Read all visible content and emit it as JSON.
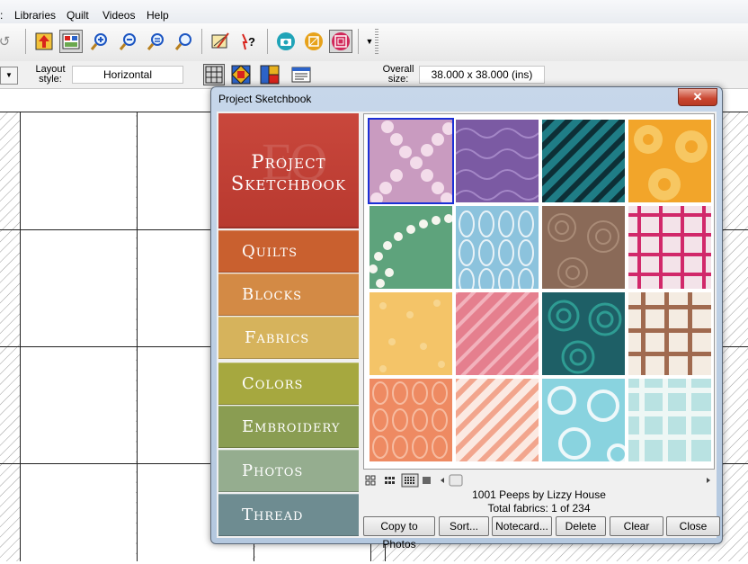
{
  "menu": {
    "items": [
      "Libraries",
      "Quilt",
      "Videos",
      "Help"
    ]
  },
  "toolbar": {
    "icons": [
      "undo-icon",
      "move-icon",
      "worktable-icon",
      "zoom-in-icon",
      "zoom-out-icon",
      "zoom-fit-icon",
      "zoom-page-icon",
      "draw-icon",
      "hint-icon",
      "camera-icon",
      "fabric-icon",
      "sketchbook-icon"
    ]
  },
  "layoutbar": {
    "layout_label_line1": "Layout",
    "layout_label_line2": "style:",
    "layout_style_value": "Horizontal",
    "overall_label_line1": "Overall",
    "overall_label_line2": "size:",
    "overall_size_value": "38.000 x 38.000 (ins)",
    "dropdown_arrow": "▼"
  },
  "dialog": {
    "title": "Project Sketchbook",
    "close_glyph": "✕",
    "header_title_line1": "Project",
    "header_title_line2": "Sketchbook",
    "header_watermark": "EQ",
    "sections": [
      {
        "label": "Quilts",
        "color": "#c9602f"
      },
      {
        "label": "Blocks",
        "color": "#d38a45"
      },
      {
        "label": "Fabrics",
        "color": "#d6b35c"
      },
      {
        "label": "Colors",
        "color": "#a6a83f"
      },
      {
        "label": "Embroidery",
        "color": "#8a9d52"
      },
      {
        "label": "Photos",
        "color": "#95ad8f"
      },
      {
        "label": "Thread",
        "color": "#6e8c91"
      }
    ],
    "selected_fabric_name": "1001 Peeps by Lizzy House",
    "total_fabrics": "Total fabrics: 1 of 234",
    "buttons": [
      "Copy to Photos",
      "Sort...",
      "Notecard...",
      "Delete",
      "Clear",
      "Close"
    ],
    "swatch_colors": [
      "#c99bc0",
      "#7b5aa3",
      "#1f7d86",
      "#f2a52a",
      "#5ea37c",
      "#8cc3dd",
      "#8a6a58",
      "#e9b1c2",
      "#f4c468",
      "#e57f8e",
      "#1e5f66",
      "#a06a4f",
      "#ee8a62",
      "#f2b7a3",
      "#89d3df",
      "#b9e2e2"
    ]
  }
}
